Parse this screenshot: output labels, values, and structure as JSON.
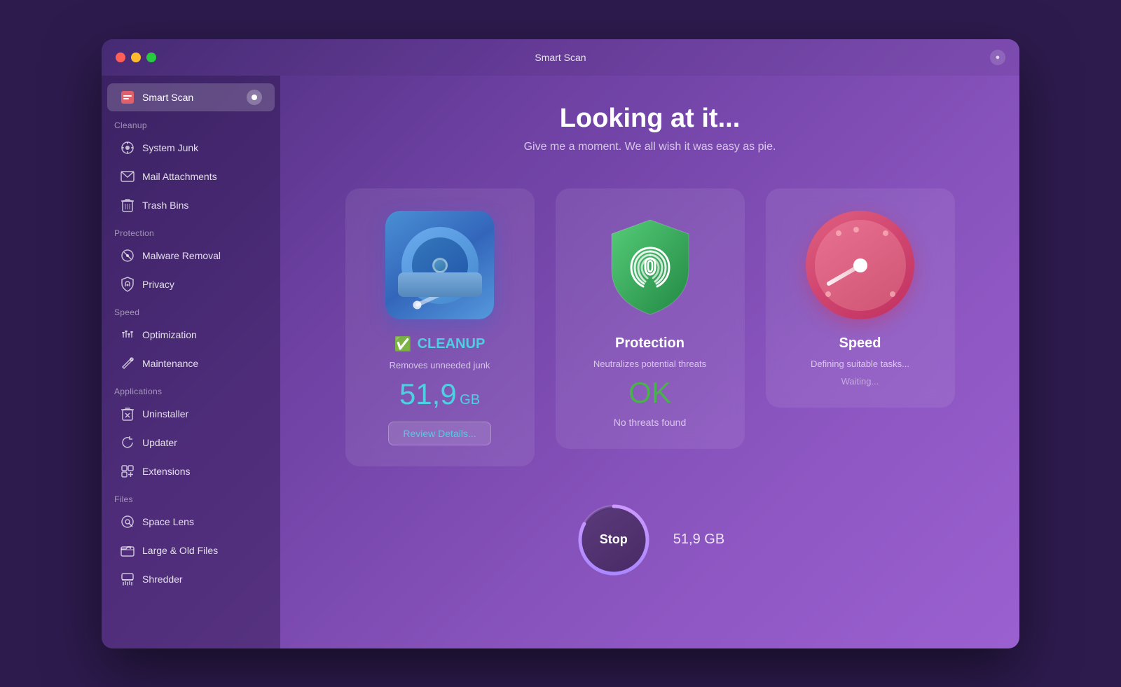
{
  "window": {
    "title": "Smart Scan",
    "traffic_lights": [
      "red",
      "yellow",
      "green"
    ]
  },
  "sidebar": {
    "active_item": "smart-scan",
    "smart_scan_label": "Smart Scan",
    "sections": [
      {
        "name": "cleanup",
        "label": "Cleanup",
        "items": [
          {
            "id": "system-junk",
            "label": "System Junk"
          },
          {
            "id": "mail-attachments",
            "label": "Mail Attachments"
          },
          {
            "id": "trash-bins",
            "label": "Trash Bins"
          }
        ]
      },
      {
        "name": "protection",
        "label": "Protection",
        "items": [
          {
            "id": "malware-removal",
            "label": "Malware Removal"
          },
          {
            "id": "privacy",
            "label": "Privacy"
          }
        ]
      },
      {
        "name": "speed",
        "label": "Speed",
        "items": [
          {
            "id": "optimization",
            "label": "Optimization"
          },
          {
            "id": "maintenance",
            "label": "Maintenance"
          }
        ]
      },
      {
        "name": "applications",
        "label": "Applications",
        "items": [
          {
            "id": "uninstaller",
            "label": "Uninstaller"
          },
          {
            "id": "updater",
            "label": "Updater"
          },
          {
            "id": "extensions",
            "label": "Extensions"
          }
        ]
      },
      {
        "name": "files",
        "label": "Files",
        "items": [
          {
            "id": "space-lens",
            "label": "Space Lens"
          },
          {
            "id": "large-old-files",
            "label": "Large & Old Files"
          },
          {
            "id": "shredder",
            "label": "Shredder"
          }
        ]
      }
    ]
  },
  "main": {
    "heading": "Looking at it...",
    "subheading": "Give me a moment. We all wish it was easy as pie.",
    "cards": [
      {
        "id": "cleanup",
        "title": "CLEANUP",
        "has_check": true,
        "subtitle": "Removes unneeded junk",
        "value": "51,9",
        "value_unit": "GB",
        "button_label": "Review Details...",
        "extra": null
      },
      {
        "id": "protection",
        "title": "Protection",
        "has_check": false,
        "subtitle": "Neutralizes potential threats",
        "value_ok": "OK",
        "no_threats": "No threats found",
        "button_label": null,
        "extra": null
      },
      {
        "id": "speed",
        "title": "Speed",
        "has_check": false,
        "subtitle": null,
        "defining": "Defining suitable tasks...",
        "waiting": "Waiting...",
        "button_label": null
      }
    ],
    "stop": {
      "label": "Stop",
      "size": "51,9 GB"
    }
  },
  "icons": {
    "smart_scan": "🛡",
    "system_junk": "⚙",
    "mail_attachments": "✉",
    "trash_bins": "🗑",
    "malware_removal": "☣",
    "privacy": "🖐",
    "optimization": "⚡",
    "maintenance": "🔧",
    "uninstaller": "💣",
    "updater": "↻",
    "extensions": "⎘",
    "space_lens": "◎",
    "large_old_files": "📁",
    "shredder": "▤"
  }
}
